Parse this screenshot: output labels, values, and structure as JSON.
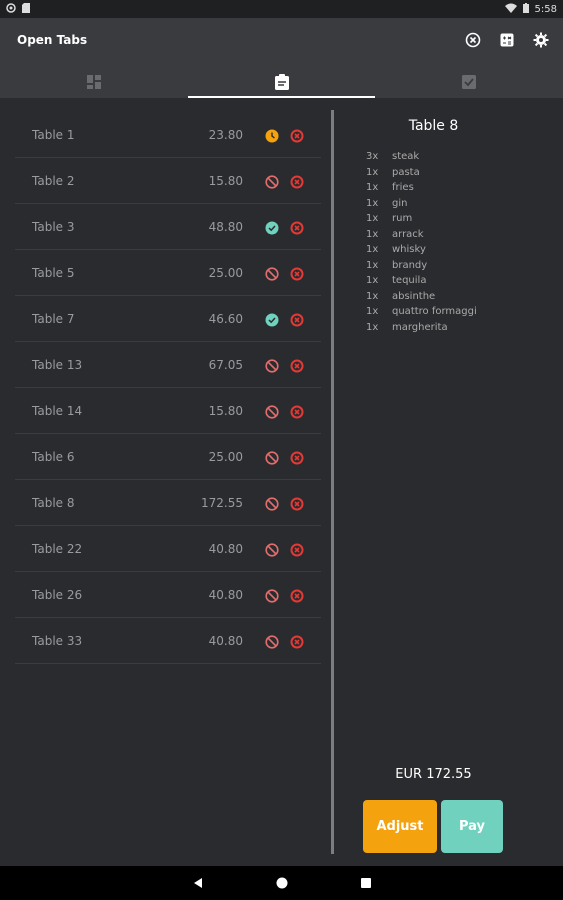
{
  "statusbar": {
    "time": "5:58"
  },
  "app": {
    "title": "Open Tabs"
  },
  "tabs": [
    {
      "icon": "grid-icon",
      "active": false
    },
    {
      "icon": "clipboard-icon",
      "active": true
    },
    {
      "icon": "check-box-icon",
      "active": false
    }
  ],
  "tables": [
    {
      "name": "Table 1",
      "amount": "23.80",
      "status": "pending"
    },
    {
      "name": "Table 2",
      "amount": "15.80",
      "status": "blocked"
    },
    {
      "name": "Table 3",
      "amount": "48.80",
      "status": "paid"
    },
    {
      "name": "Table 5",
      "amount": "25.00",
      "status": "blocked"
    },
    {
      "name": "Table 7",
      "amount": "46.60",
      "status": "paid"
    },
    {
      "name": "Table 13",
      "amount": "67.05",
      "status": "blocked"
    },
    {
      "name": "Table 14",
      "amount": "15.80",
      "status": "blocked"
    },
    {
      "name": "Table 6",
      "amount": "25.00",
      "status": "blocked"
    },
    {
      "name": "Table 8",
      "amount": "172.55",
      "status": "blocked"
    },
    {
      "name": "Table 22",
      "amount": "40.80",
      "status": "blocked"
    },
    {
      "name": "Table 26",
      "amount": "40.80",
      "status": "blocked"
    },
    {
      "name": "Table 33",
      "amount": "40.80",
      "status": "blocked"
    }
  ],
  "detail": {
    "title": "Table 8",
    "items": [
      {
        "qty": "3x",
        "name": "steak"
      },
      {
        "qty": "1x",
        "name": "pasta"
      },
      {
        "qty": "1x",
        "name": "fries"
      },
      {
        "qty": "1x",
        "name": "gin"
      },
      {
        "qty": "1x",
        "name": "rum"
      },
      {
        "qty": "1x",
        "name": "arrack"
      },
      {
        "qty": "1x",
        "name": "whisky"
      },
      {
        "qty": "1x",
        "name": "brandy"
      },
      {
        "qty": "1x",
        "name": "tequila"
      },
      {
        "qty": "1x",
        "name": "absinthe"
      },
      {
        "qty": "1x",
        "name": "quattro formaggi"
      },
      {
        "qty": "1x",
        "name": "margherita"
      }
    ],
    "total": "EUR 172.55",
    "adjust_label": "Adjust",
    "pay_label": "Pay"
  },
  "colors": {
    "accent_orange": "#f5a20f",
    "accent_teal": "#6fd1be",
    "danger_red": "#e53935"
  }
}
